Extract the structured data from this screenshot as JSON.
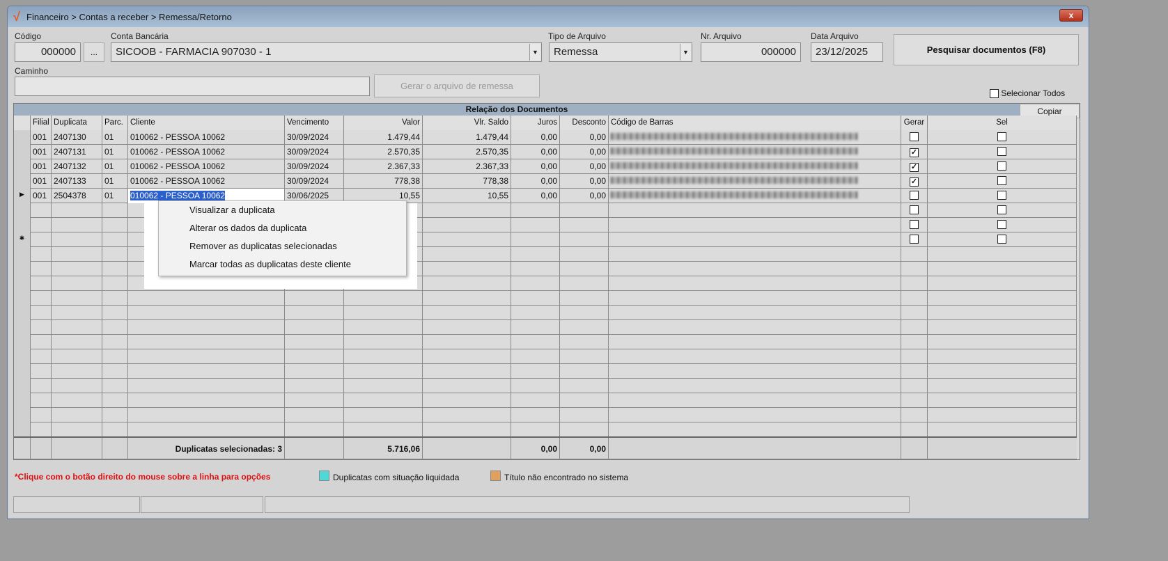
{
  "window": {
    "title": "Financeiro > Contas a receber > Remessa/Retorno",
    "close": "x"
  },
  "form": {
    "codigo_label": "Código",
    "codigo": "000000",
    "browse": "...",
    "conta_label": "Conta Bancária",
    "conta": "SICOOB - FARMACIA 907030 - 1",
    "tipo_label": "Tipo de Arquivo",
    "tipo": "Remessa",
    "nr_label": "Nr. Arquivo",
    "nr": "000000",
    "data_label": "Data Arquivo",
    "data": "23/12/2025",
    "pesquisar": "Pesquisar documentos (F8)",
    "caminho_label": "Caminho",
    "caminho": "",
    "gerar": "Gerar o arquivo de remessa",
    "selecionar_todos": "Selecionar Todos"
  },
  "grid": {
    "title": "Relação dos Documentos",
    "copiar": "Copiar",
    "columns": [
      "Filial",
      "Duplicata",
      "Parc.",
      "Cliente",
      "Vencimento",
      "Valor",
      "Vlr. Saldo",
      "Juros",
      "Desconto",
      "Código de Barras",
      "Gerar",
      "Sel"
    ],
    "rows": [
      {
        "filial": "001",
        "duplicata": "2407130",
        "parc": "01",
        "cliente": "010062 - PESSOA 10062",
        "venc": "30/09/2024",
        "valor": "1.479,44",
        "saldo": "1.479,44",
        "juros": "0,00",
        "desconto": "0,00",
        "gerar": false,
        "sel": false
      },
      {
        "filial": "001",
        "duplicata": "2407131",
        "parc": "01",
        "cliente": "010062 - PESSOA 10062",
        "venc": "30/09/2024",
        "valor": "2.570,35",
        "saldo": "2.570,35",
        "juros": "0,00",
        "desconto": "0,00",
        "gerar": true,
        "sel": false
      },
      {
        "filial": "001",
        "duplicata": "2407132",
        "parc": "01",
        "cliente": "010062 - PESSOA 10062",
        "venc": "30/09/2024",
        "valor": "2.367,33",
        "saldo": "2.367,33",
        "juros": "0,00",
        "desconto": "0,00",
        "gerar": true,
        "sel": false
      },
      {
        "filial": "001",
        "duplicata": "2407133",
        "parc": "01",
        "cliente": "010062 - PESSOA 10062",
        "venc": "30/09/2024",
        "valor": "778,38",
        "saldo": "778,38",
        "juros": "0,00",
        "desconto": "0,00",
        "gerar": true,
        "sel": false
      },
      {
        "filial": "001",
        "duplicata": "2504378",
        "parc": "01",
        "cliente": "010062 - PESSOA 10062",
        "venc": "30/06/2025",
        "valor": "10,55",
        "saldo": "10,55",
        "juros": "0,00",
        "desconto": "0,00",
        "gerar": false,
        "sel": false,
        "current": true
      }
    ],
    "footer": {
      "selecionadas": "Duplicatas selecionadas: 3",
      "valor": "5.716,06",
      "juros": "0,00",
      "desconto": "0,00"
    }
  },
  "context_menu": [
    "Visualizar a duplicata",
    "Alterar os dados da duplicata",
    "Remover as duplicatas selecionadas",
    "Marcar todas as duplicatas deste cliente"
  ],
  "legend": {
    "hint": "*Clique com o botão direito do mouse sobre a linha para opções",
    "liquidada": "Duplicatas com situação liquidada",
    "liquidada_color": "#4fd8d8",
    "nao_encontrado": "Título não encontrado no sistema",
    "nao_encontrado_color": "#e0a060",
    "hint_color": "#e01010"
  }
}
